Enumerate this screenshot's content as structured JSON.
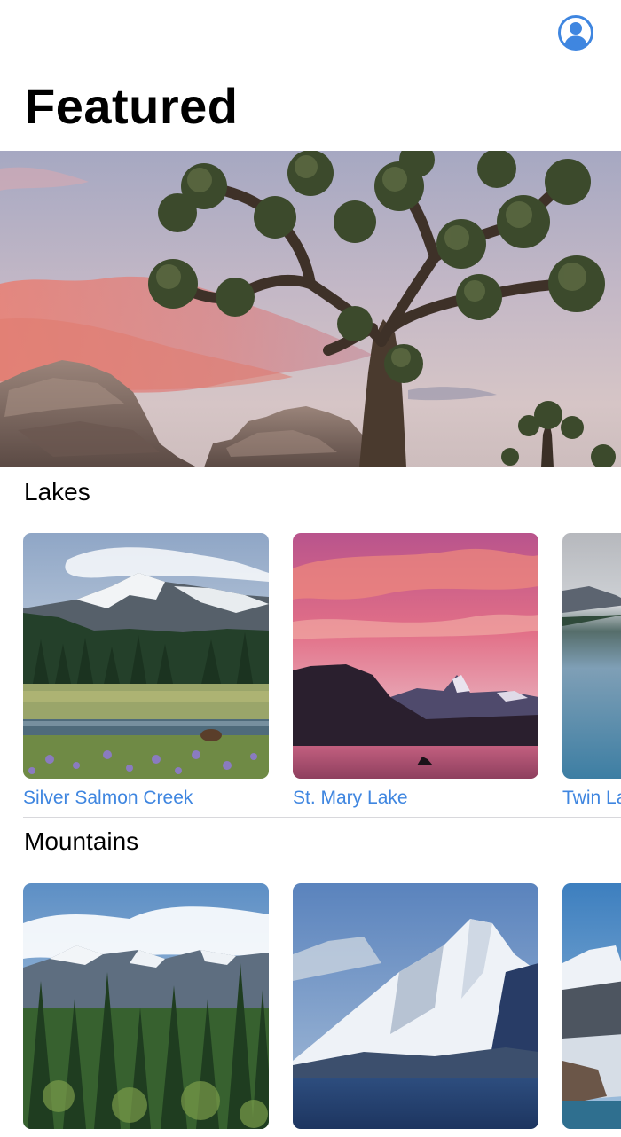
{
  "header": {
    "title": "Featured",
    "profile_icon": "person-circle-icon"
  },
  "hero": {
    "image_subject": "joshua-tree-at-sunset"
  },
  "sections": [
    {
      "title": "Lakes",
      "items": [
        {
          "label": "Silver Salmon Creek"
        },
        {
          "label": "St. Mary Lake"
        },
        {
          "label": "Twin Lake"
        }
      ]
    },
    {
      "title": "Mountains",
      "items": [
        {
          "label": ""
        },
        {
          "label": ""
        },
        {
          "label": ""
        }
      ]
    }
  ],
  "colors": {
    "accent": "#3f86e0",
    "background": "#ffffff",
    "divider": "#d8d8dc",
    "title": "#000000"
  }
}
